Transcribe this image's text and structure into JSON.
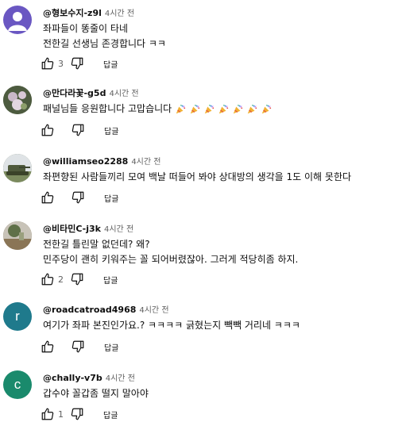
{
  "comments": [
    {
      "author": "@형보수지-z9l",
      "time": "4시간 전",
      "lines": [
        "좌파들이 똥줄이 타네",
        "전한길 선생님 존경합니다 ㅋㅋ"
      ],
      "likes": "3",
      "reply_label": "답글",
      "avatar": {
        "type": "icon",
        "color": "#6a57c2",
        "icon": "person-silhouette-icon"
      }
    },
    {
      "author": "@만다라꽃-g5d",
      "time": "4시간 전",
      "lines": [
        "패널님들 응원합니다 고맙습니다"
      ],
      "emoji_count": 7,
      "emoji_icon": "party-popper-icon",
      "likes": "",
      "reply_label": "답글",
      "avatar": {
        "type": "photo",
        "color": "#6b7a5a",
        "icon": "flower-photo-icon"
      }
    },
    {
      "author": "@williamseo2288",
      "time": "4시간 전",
      "lines": [
        "좌편향된 사람들끼리 모여 백날 떠들어 봐야 상대방의 생각을 1도 이해 못한다"
      ],
      "likes": "",
      "reply_label": "답글",
      "avatar": {
        "type": "photo",
        "color": "#5a6b4d",
        "icon": "tank-photo-icon"
      }
    },
    {
      "author": "@비타민C-j3k",
      "time": "4시간 전",
      "lines": [
        "전한길 틀린말 없던데? 왜?",
        "민주당이 괜히 키워주는 꼴 되어버렸잖아. 그러게 적당히좀 하지."
      ],
      "likes": "2",
      "reply_label": "답글",
      "avatar": {
        "type": "photo",
        "color": "#7a6a4f",
        "icon": "landscape-photo-icon"
      }
    },
    {
      "author": "@roadcatroad4968",
      "time": "4시간 전",
      "lines": [
        "여기가 좌파 본진인가요.? ㅋㅋㅋㅋ 긁혔는지  빽빽 거리네 ㅋㅋㅋ"
      ],
      "likes": "",
      "reply_label": "답글",
      "avatar": {
        "type": "letter",
        "letter": "r",
        "color": "#1f7a8c"
      }
    },
    {
      "author": "@chally-v7b",
      "time": "4시간 전",
      "lines": [
        "갑수야 꼴갑좀 떨지 말아야"
      ],
      "likes": "1",
      "reply_label": "답글",
      "avatar": {
        "type": "letter",
        "letter": "c",
        "color": "#1a8a6c"
      }
    }
  ]
}
